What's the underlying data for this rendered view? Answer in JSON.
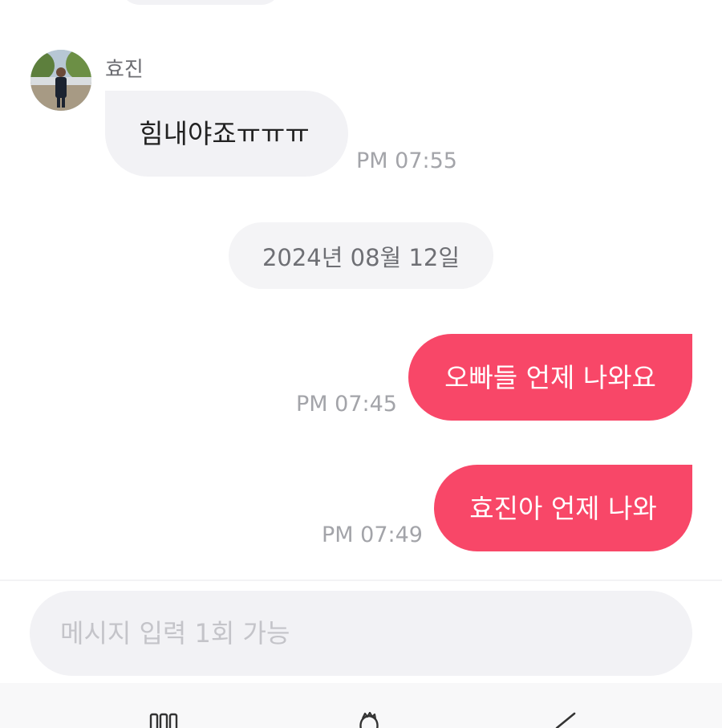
{
  "messages": [
    {
      "direction": "incoming",
      "sender": "효진",
      "text": "힘내야죠ㅠㅠㅠ",
      "time": "PM 07:55"
    }
  ],
  "date_divider": "2024년 08월 12일",
  "sent_messages": [
    {
      "direction": "outgoing",
      "text": "오빠들 언제 나와요",
      "time": "PM 07:45"
    },
    {
      "direction": "outgoing",
      "text": "효진아 언제 나와",
      "time": "PM 07:49"
    }
  ],
  "composer": {
    "placeholder": "메시지 입력 1회 가능",
    "value": ""
  },
  "nav": {
    "icons": [
      "menu-icon",
      "home-icon",
      "back-icon"
    ]
  },
  "colors": {
    "outgoing_bubble": "#f84768",
    "incoming_bubble": "#f2f2f5",
    "timestamp": "#a3a4a9",
    "date_divider_bg": "#f4f4f6"
  }
}
